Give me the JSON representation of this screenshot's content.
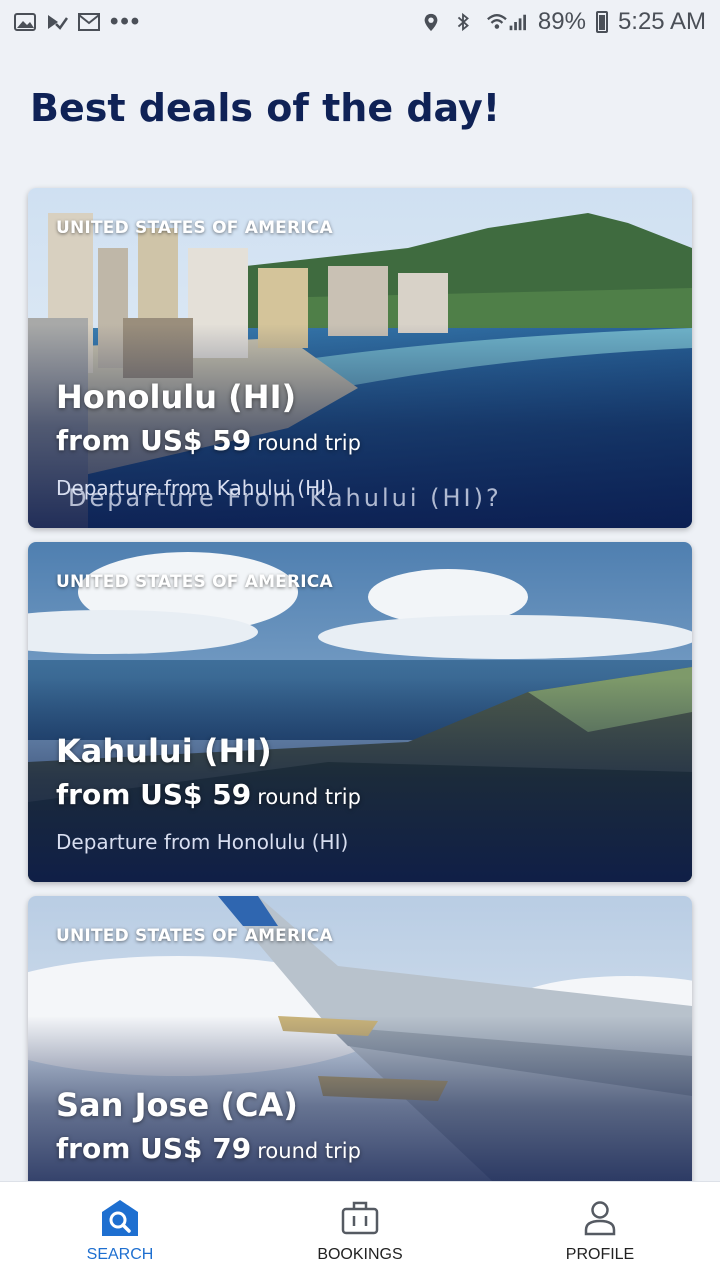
{
  "status_bar": {
    "battery": "89%",
    "time": "5:25 AM",
    "more": "•••"
  },
  "page": {
    "title": "Best deals of the day!"
  },
  "deals": [
    {
      "country": "UNITED STATES OF AMERICA",
      "city": "Honolulu (HI)",
      "price": "from US$ 59",
      "trip_type": "round trip",
      "departure": "Departure from Kahului (HI)",
      "overlay": "Departure From Kahului (HI)?"
    },
    {
      "country": "UNITED STATES OF AMERICA",
      "city": "Kahului (HI)",
      "price": "from US$ 59",
      "trip_type": "round trip",
      "departure": "Departure from Honolulu (HI)"
    },
    {
      "country": "UNITED STATES OF AMERICA",
      "city": "San Jose (CA)",
      "price": "from US$ 79",
      "trip_type": "round trip"
    }
  ],
  "bottom_nav": [
    {
      "label": "SEARCH",
      "icon": "search-icon",
      "active": true
    },
    {
      "label": "BOOKINGS",
      "icon": "briefcase-icon",
      "active": false
    },
    {
      "label": "PROFILE",
      "icon": "person-icon",
      "active": false
    }
  ],
  "colors": {
    "accent": "#1e6fd0",
    "title": "#0f2256",
    "background": "#eef1f6"
  }
}
